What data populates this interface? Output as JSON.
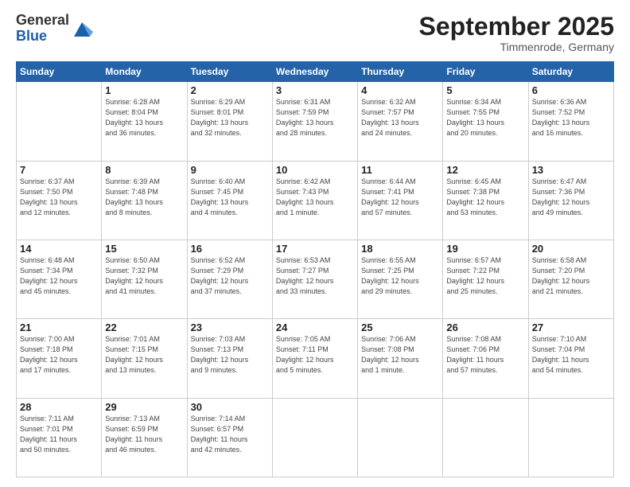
{
  "header": {
    "logo_general": "General",
    "logo_blue": "Blue",
    "month_title": "September 2025",
    "location": "Timmenrode, Germany"
  },
  "weekdays": [
    "Sunday",
    "Monday",
    "Tuesday",
    "Wednesday",
    "Thursday",
    "Friday",
    "Saturday"
  ],
  "weeks": [
    [
      {
        "day": "",
        "info": ""
      },
      {
        "day": "1",
        "info": "Sunrise: 6:28 AM\nSunset: 8:04 PM\nDaylight: 13 hours\nand 36 minutes."
      },
      {
        "day": "2",
        "info": "Sunrise: 6:29 AM\nSunset: 8:01 PM\nDaylight: 13 hours\nand 32 minutes."
      },
      {
        "day": "3",
        "info": "Sunrise: 6:31 AM\nSunset: 7:59 PM\nDaylight: 13 hours\nand 28 minutes."
      },
      {
        "day": "4",
        "info": "Sunrise: 6:32 AM\nSunset: 7:57 PM\nDaylight: 13 hours\nand 24 minutes."
      },
      {
        "day": "5",
        "info": "Sunrise: 6:34 AM\nSunset: 7:55 PM\nDaylight: 13 hours\nand 20 minutes."
      },
      {
        "day": "6",
        "info": "Sunrise: 6:36 AM\nSunset: 7:52 PM\nDaylight: 13 hours\nand 16 minutes."
      }
    ],
    [
      {
        "day": "7",
        "info": "Sunrise: 6:37 AM\nSunset: 7:50 PM\nDaylight: 13 hours\nand 12 minutes."
      },
      {
        "day": "8",
        "info": "Sunrise: 6:39 AM\nSunset: 7:48 PM\nDaylight: 13 hours\nand 8 minutes."
      },
      {
        "day": "9",
        "info": "Sunrise: 6:40 AM\nSunset: 7:45 PM\nDaylight: 13 hours\nand 4 minutes."
      },
      {
        "day": "10",
        "info": "Sunrise: 6:42 AM\nSunset: 7:43 PM\nDaylight: 13 hours\nand 1 minute."
      },
      {
        "day": "11",
        "info": "Sunrise: 6:44 AM\nSunset: 7:41 PM\nDaylight: 12 hours\nand 57 minutes."
      },
      {
        "day": "12",
        "info": "Sunrise: 6:45 AM\nSunset: 7:38 PM\nDaylight: 12 hours\nand 53 minutes."
      },
      {
        "day": "13",
        "info": "Sunrise: 6:47 AM\nSunset: 7:36 PM\nDaylight: 12 hours\nand 49 minutes."
      }
    ],
    [
      {
        "day": "14",
        "info": "Sunrise: 6:48 AM\nSunset: 7:34 PM\nDaylight: 12 hours\nand 45 minutes."
      },
      {
        "day": "15",
        "info": "Sunrise: 6:50 AM\nSunset: 7:32 PM\nDaylight: 12 hours\nand 41 minutes."
      },
      {
        "day": "16",
        "info": "Sunrise: 6:52 AM\nSunset: 7:29 PM\nDaylight: 12 hours\nand 37 minutes."
      },
      {
        "day": "17",
        "info": "Sunrise: 6:53 AM\nSunset: 7:27 PM\nDaylight: 12 hours\nand 33 minutes."
      },
      {
        "day": "18",
        "info": "Sunrise: 6:55 AM\nSunset: 7:25 PM\nDaylight: 12 hours\nand 29 minutes."
      },
      {
        "day": "19",
        "info": "Sunrise: 6:57 AM\nSunset: 7:22 PM\nDaylight: 12 hours\nand 25 minutes."
      },
      {
        "day": "20",
        "info": "Sunrise: 6:58 AM\nSunset: 7:20 PM\nDaylight: 12 hours\nand 21 minutes."
      }
    ],
    [
      {
        "day": "21",
        "info": "Sunrise: 7:00 AM\nSunset: 7:18 PM\nDaylight: 12 hours\nand 17 minutes."
      },
      {
        "day": "22",
        "info": "Sunrise: 7:01 AM\nSunset: 7:15 PM\nDaylight: 12 hours\nand 13 minutes."
      },
      {
        "day": "23",
        "info": "Sunrise: 7:03 AM\nSunset: 7:13 PM\nDaylight: 12 hours\nand 9 minutes."
      },
      {
        "day": "24",
        "info": "Sunrise: 7:05 AM\nSunset: 7:11 PM\nDaylight: 12 hours\nand 5 minutes."
      },
      {
        "day": "25",
        "info": "Sunrise: 7:06 AM\nSunset: 7:08 PM\nDaylight: 12 hours\nand 1 minute."
      },
      {
        "day": "26",
        "info": "Sunrise: 7:08 AM\nSunset: 7:06 PM\nDaylight: 11 hours\nand 57 minutes."
      },
      {
        "day": "27",
        "info": "Sunrise: 7:10 AM\nSunset: 7:04 PM\nDaylight: 11 hours\nand 54 minutes."
      }
    ],
    [
      {
        "day": "28",
        "info": "Sunrise: 7:11 AM\nSunset: 7:01 PM\nDaylight: 11 hours\nand 50 minutes."
      },
      {
        "day": "29",
        "info": "Sunrise: 7:13 AM\nSunset: 6:59 PM\nDaylight: 11 hours\nand 46 minutes."
      },
      {
        "day": "30",
        "info": "Sunrise: 7:14 AM\nSunset: 6:57 PM\nDaylight: 11 hours\nand 42 minutes."
      },
      {
        "day": "",
        "info": ""
      },
      {
        "day": "",
        "info": ""
      },
      {
        "day": "",
        "info": ""
      },
      {
        "day": "",
        "info": ""
      }
    ]
  ]
}
